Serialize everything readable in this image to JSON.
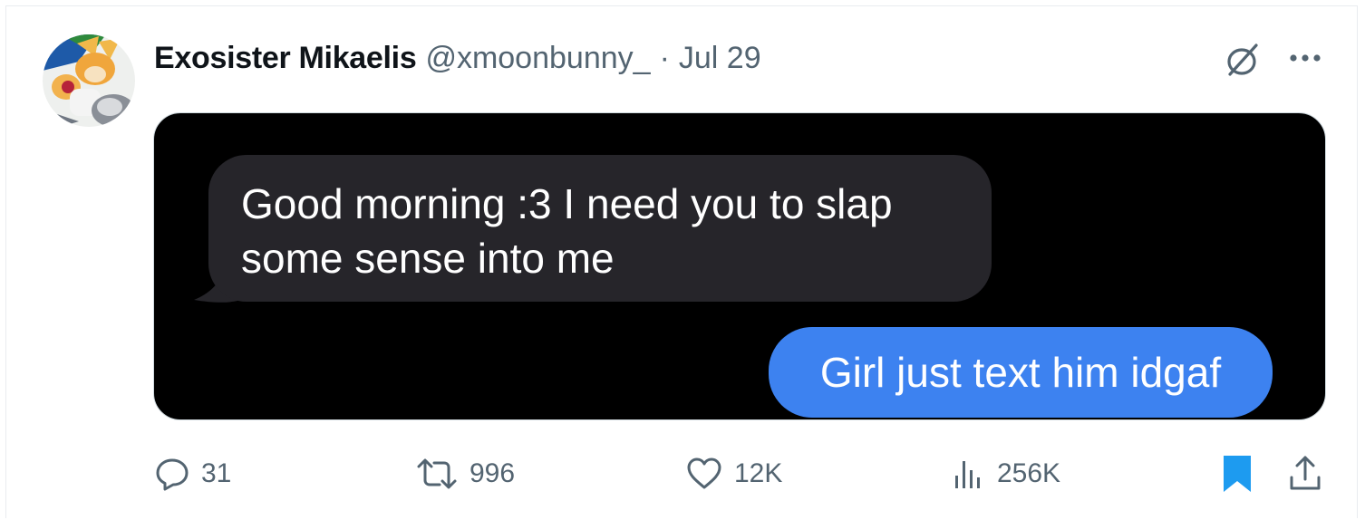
{
  "post": {
    "author_name": "Exosister Mikaelis",
    "author_handle": "@xmoonbunny_",
    "separator": "·",
    "date": "Jul 29"
  },
  "media": {
    "incoming_message": "Good morning :3 I need you to slap some sense into me",
    "outgoing_message": "Girl just text him idgaf",
    "colors": {
      "background": "#000000",
      "incoming_bubble": "#26252a",
      "outgoing_bubble": "#3d82f0"
    }
  },
  "actions": {
    "replies": "31",
    "reposts": "996",
    "likes": "12K",
    "views": "256K"
  },
  "icons": {
    "header": [
      "grok-icon",
      "more-icon"
    ],
    "actions": [
      "reply-icon",
      "retweet-icon",
      "like-icon",
      "views-icon",
      "bookmark-icon",
      "share-icon"
    ]
  },
  "colors": {
    "text_primary": "#0f1419",
    "text_secondary": "#536471",
    "bookmark_active": "#1d9bf0"
  }
}
